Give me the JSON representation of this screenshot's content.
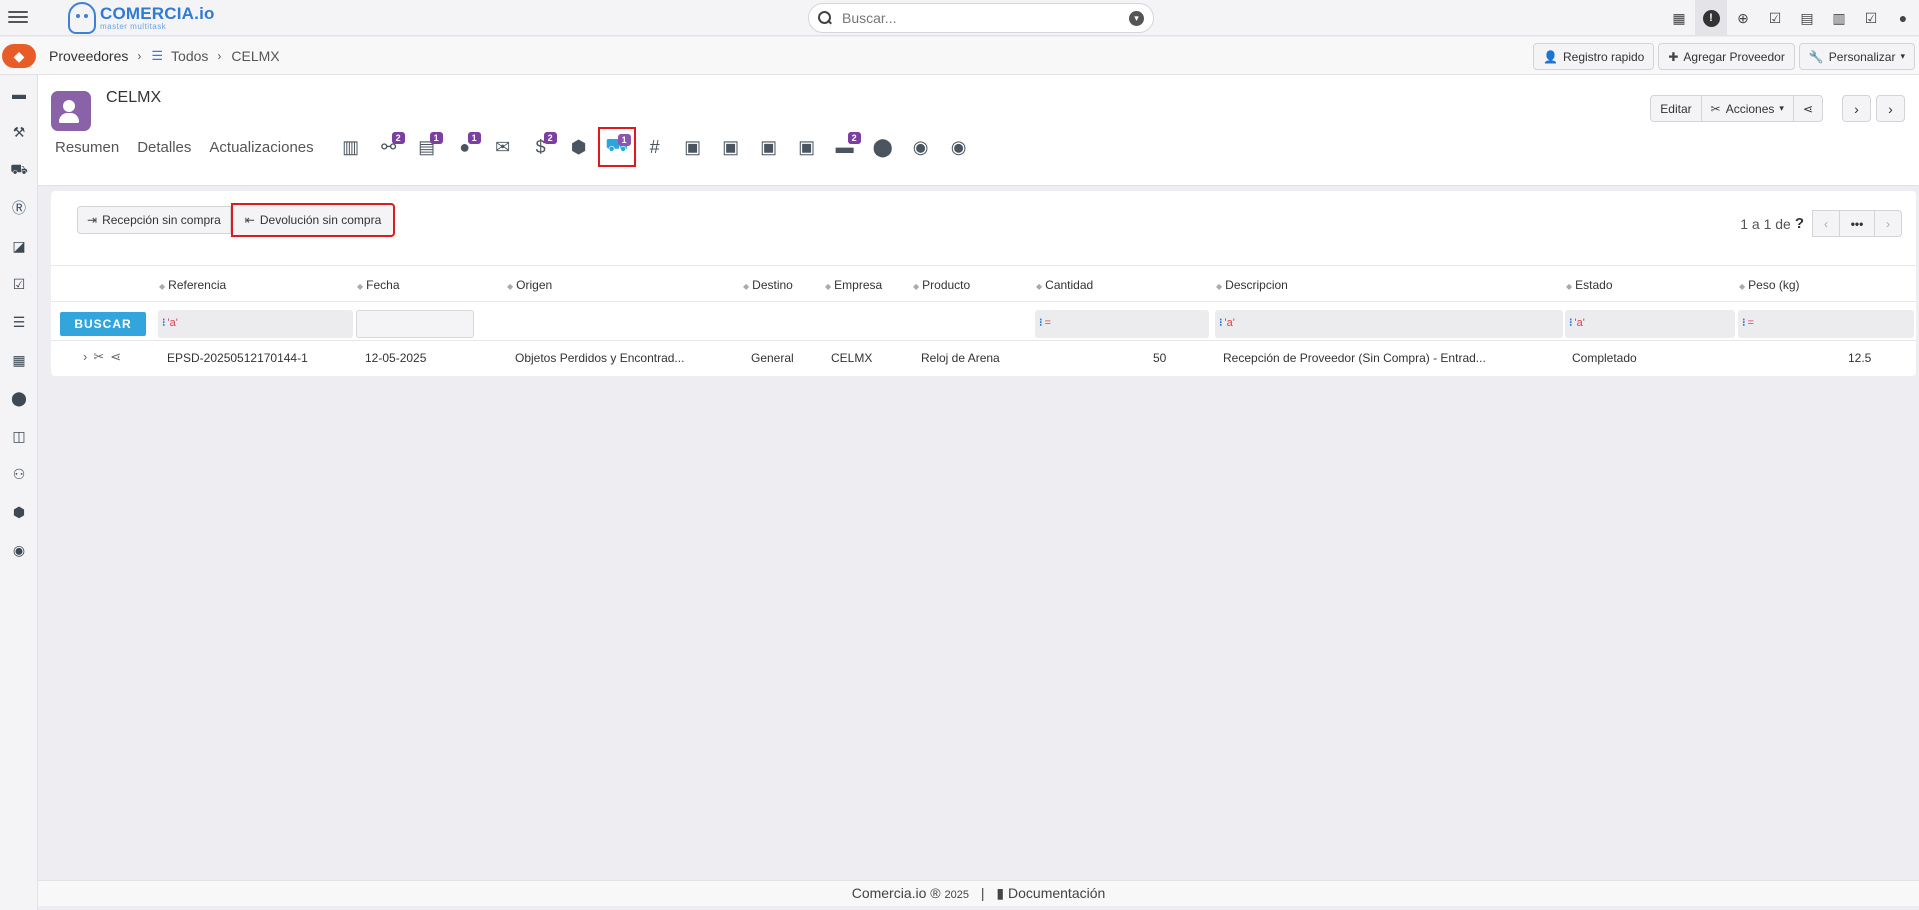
{
  "topbar": {
    "logo_title": "COMERCIA.io",
    "logo_subtitle": "master multitask",
    "search_placeholder": "Buscar...",
    "icons": [
      "cash-register-icon",
      "alert-icon",
      "add-circle-icon",
      "calendar-check-icon",
      "calendar-icon",
      "bar-chart-icon",
      "checkbox-icon",
      "user-icon"
    ]
  },
  "breadcrumb": {
    "root": "Proveedores",
    "list": "Todos",
    "current": "CELMX",
    "actions": {
      "registro_rapido": "Registro rapido",
      "agregar_proveedor": "Agregar Proveedor",
      "personalizar": "Personalizar"
    }
  },
  "sidebar": {
    "items": [
      "boxes-icon",
      "hammer-icon",
      "cart-icon",
      "r-circle-icon",
      "tags-icon",
      "checkbox-icon",
      "list-icon",
      "calculator-icon",
      "map-pin-icon",
      "nodes-icon",
      "users-icon",
      "cube-icon",
      "chat-icon"
    ]
  },
  "header": {
    "title": "CELMX",
    "editar": "Editar",
    "acciones": "Acciones",
    "tabs": {
      "resumen": "Resumen",
      "detalles": "Detalles",
      "actualizaciones": "Actualizaciones"
    },
    "tab_icons": [
      {
        "name": "bar-chart-icon",
        "badge": ""
      },
      {
        "name": "handshake-icon",
        "badge": "2"
      },
      {
        "name": "purchase-order-icon",
        "badge": "1"
      },
      {
        "name": "contact-icon",
        "badge": "1"
      },
      {
        "name": "envelope-icon",
        "badge": ""
      },
      {
        "name": "money-hand-icon",
        "badge": "2"
      },
      {
        "name": "box-open-icon",
        "badge": ""
      },
      {
        "name": "cart-return-icon",
        "badge": "1"
      },
      {
        "name": "hashtag-icon",
        "badge": ""
      },
      {
        "name": "invoice-f-icon",
        "badge": ""
      },
      {
        "name": "credit-note-icon",
        "badge": ""
      },
      {
        "name": "doc-p-icon",
        "badge": ""
      },
      {
        "name": "doc-t-icon",
        "badge": ""
      },
      {
        "name": "credit-card-icon",
        "badge": "2"
      },
      {
        "name": "map-pin-icon",
        "badge": ""
      },
      {
        "name": "comments-icon",
        "badge": ""
      },
      {
        "name": "comment-dots-icon",
        "badge": ""
      }
    ]
  },
  "panel": {
    "recepcion_btn": "Recepción sin compra",
    "devolucion_btn": "Devolución sin compra",
    "pager_text": "1 a 1  de",
    "pager_help": "?",
    "buscar": "BUSCAR",
    "columns": [
      "Referencia",
      "Fecha",
      "Origen",
      "Destino",
      "Empresa",
      "Producto",
      "Cantidad",
      "Descripcion",
      "Estado",
      "Peso (kg)"
    ],
    "filters": {
      "referencia": "'a'",
      "cantidad": "=",
      "descripcion": "'a'",
      "estado": "'a'",
      "peso": "="
    },
    "rows": [
      {
        "referencia": "EPSD-20250512170144-1",
        "fecha": "12-05-2025",
        "origen": "Objetos Perdidos y Encontrad...",
        "destino": "General",
        "empresa": "CELMX",
        "producto": "Reloj de Arena",
        "cantidad": "50",
        "descripcion": "Recepción de Proveedor (Sin Compra) - Entrad...",
        "estado": "Completado",
        "peso": "12.5"
      }
    ]
  },
  "footer": {
    "brand": "Comercia.io ®",
    "year": "2025",
    "doc": "Documentación"
  },
  "colors": {
    "accent_blue": "#31a5dc",
    "badge_purple": "#7a3fa0",
    "highlight_red": "#e0191d",
    "tag_orange": "#e85d27"
  }
}
